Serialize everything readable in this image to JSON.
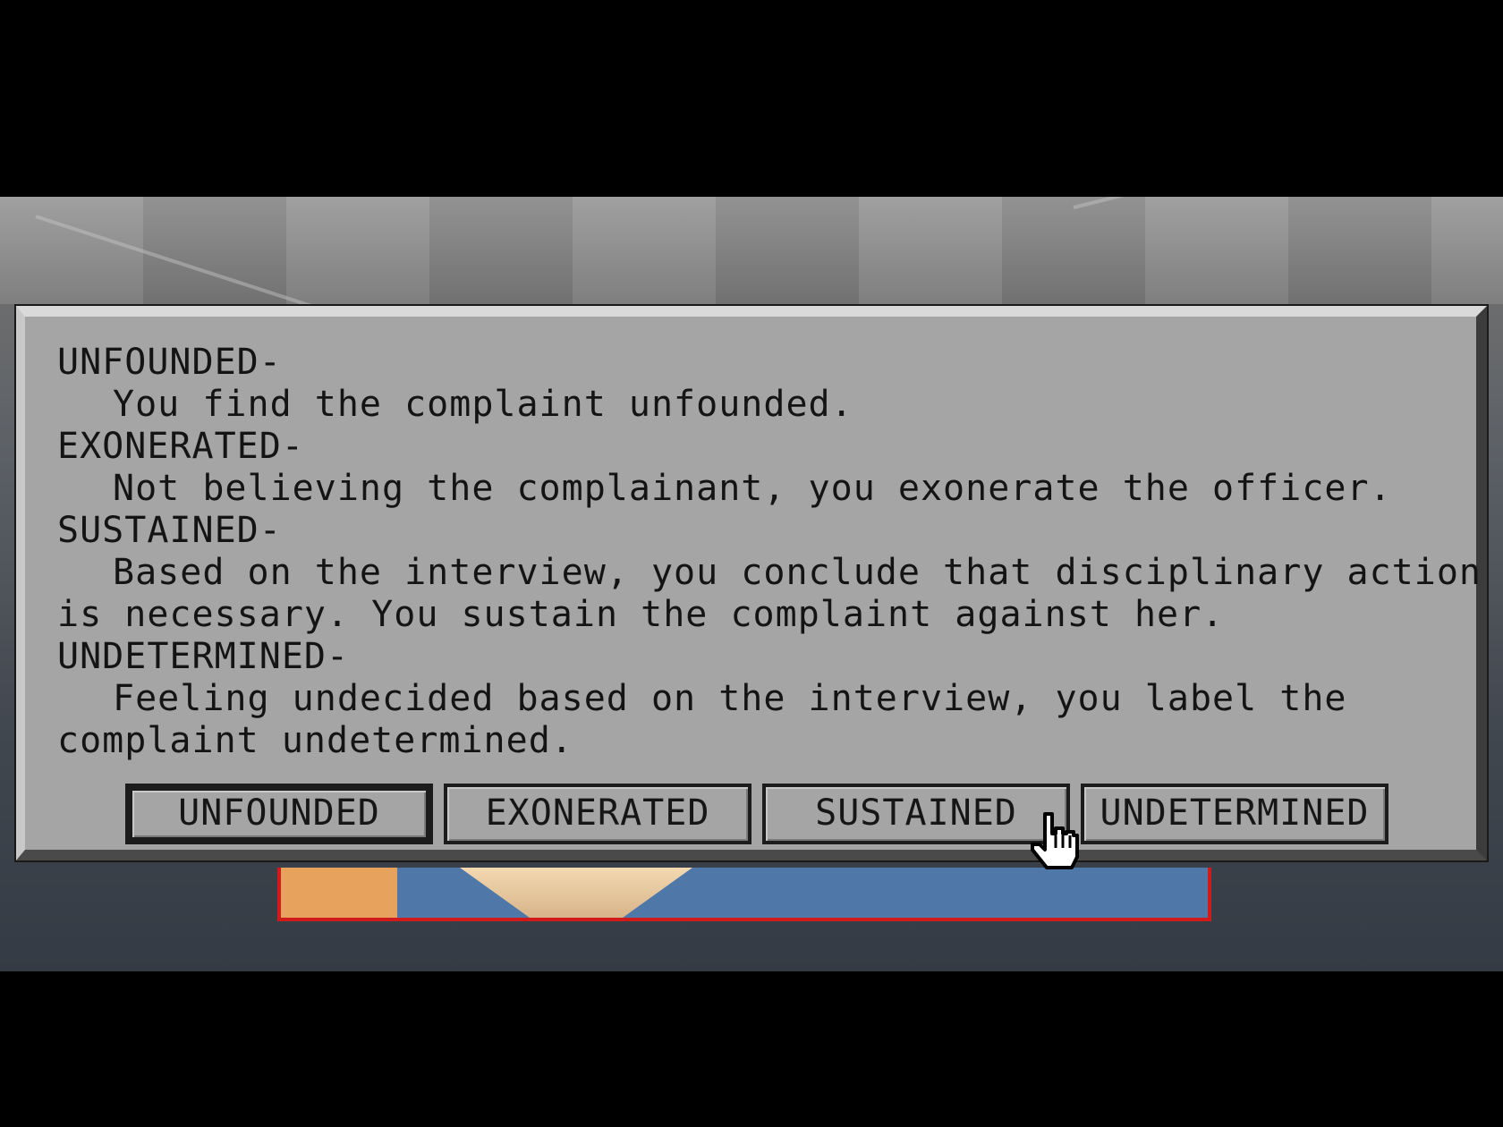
{
  "dialog": {
    "lines": [
      {
        "text": "UNFOUNDED-",
        "indent": false
      },
      {
        "text": "You find the complaint unfounded.",
        "indent": true
      },
      {
        "text": "EXONERATED-",
        "indent": false
      },
      {
        "text": "Not believing the complainant, you exonerate the officer.",
        "indent": true
      },
      {
        "text": "SUSTAINED-",
        "indent": false
      },
      {
        "text": "Based on the interview, you conclude that disciplinary action",
        "indent": true
      },
      {
        "text": "is necessary. You sustain the complaint against her.",
        "indent": false
      },
      {
        "text": "UNDETERMINED-",
        "indent": false
      },
      {
        "text": "Feeling undecided based on the interview, you label the",
        "indent": true
      },
      {
        "text": "complaint undetermined.",
        "indent": false
      }
    ],
    "buttons": [
      {
        "label": "UNFOUNDED",
        "selected": true
      },
      {
        "label": "EXONERATED",
        "selected": false
      },
      {
        "label": "SUSTAINED",
        "selected": false
      },
      {
        "label": "UNDETERMINED",
        "selected": false
      }
    ]
  },
  "cursor": {
    "icon": "hand-pointer-icon"
  },
  "colors": {
    "dialog_bg": "#a5a5a5",
    "text": "#141414",
    "portrait_border": "#d11a1a",
    "letterbox": "#000000"
  }
}
